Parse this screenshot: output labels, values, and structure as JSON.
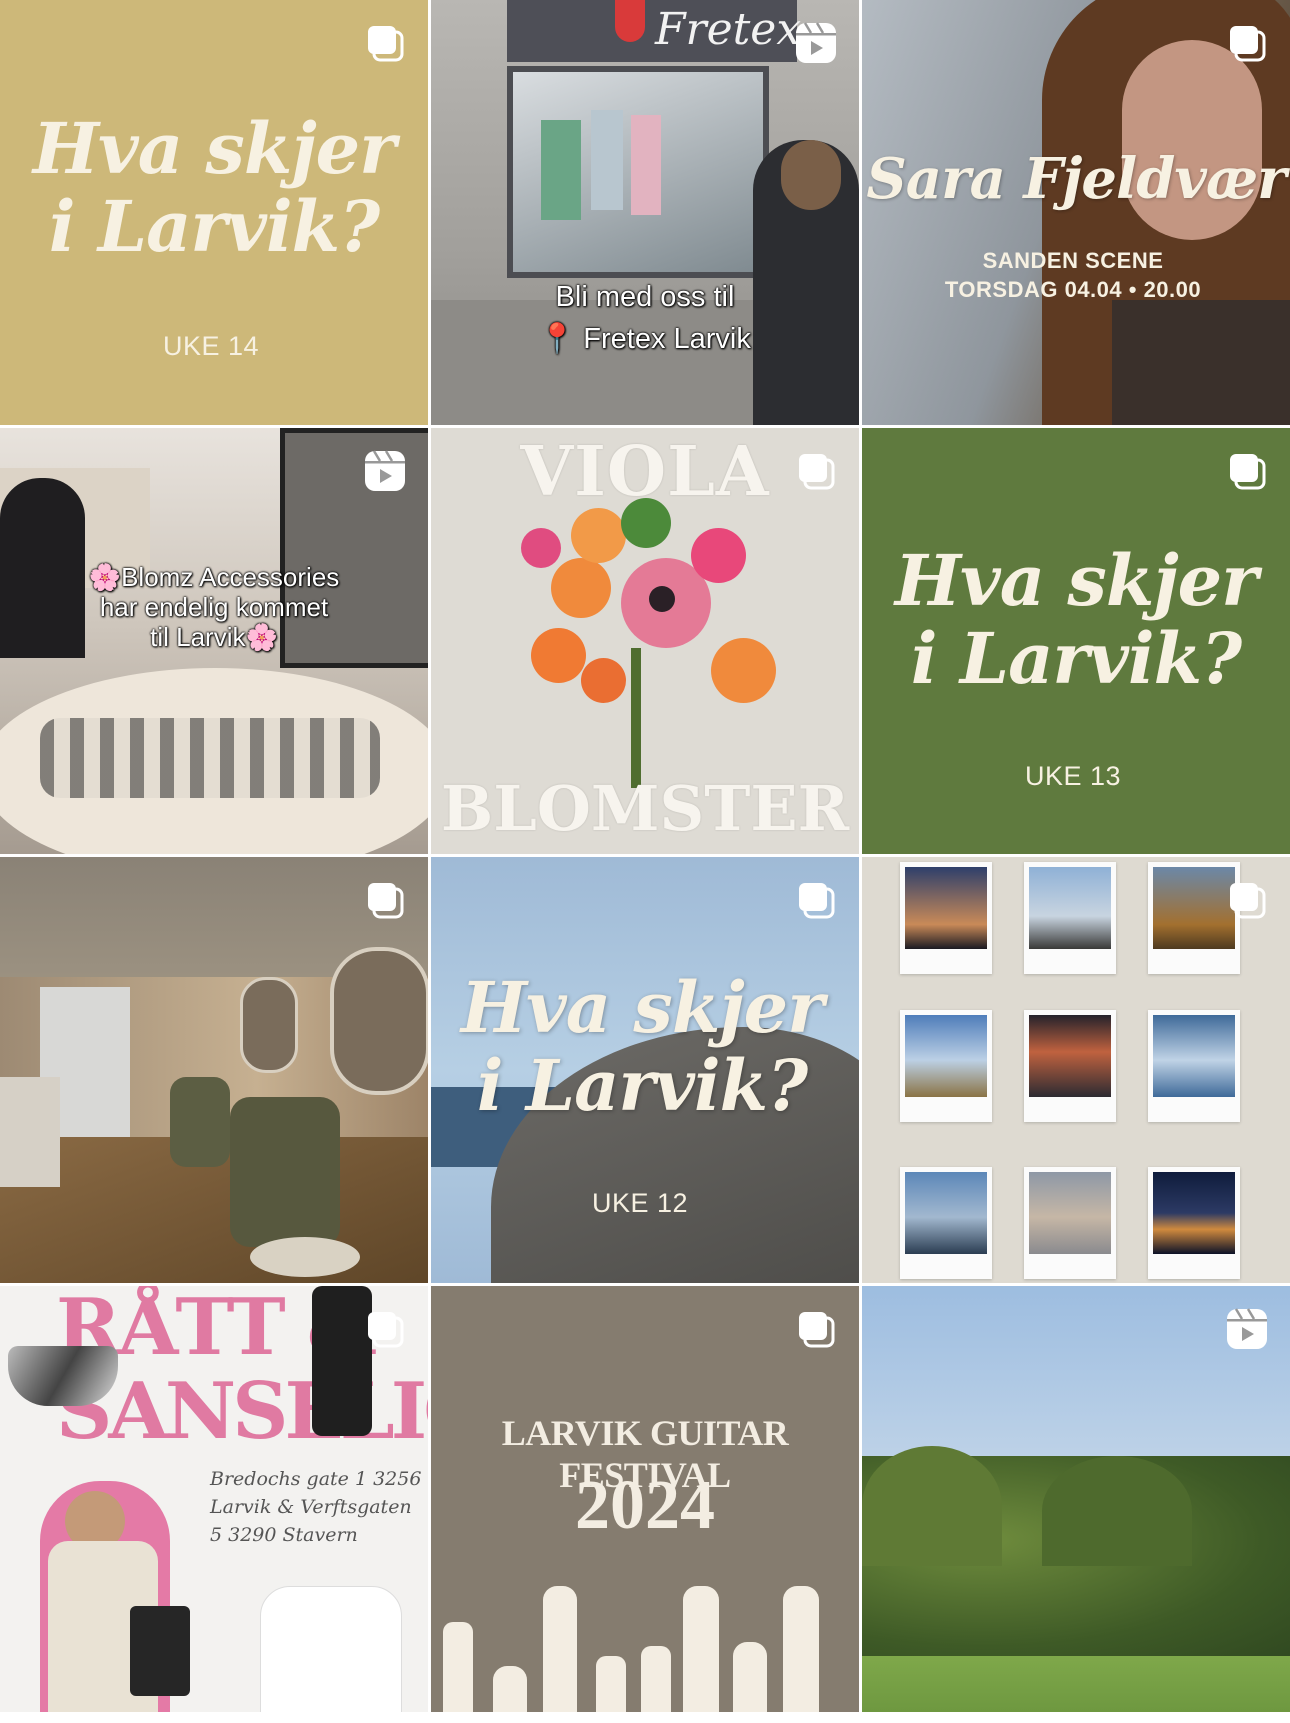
{
  "tiles": {
    "t1": {
      "title_line1": "Hva skjer",
      "title_line2": "i Larvik?",
      "week": "UKE 14",
      "badge": "carousel-icon",
      "bg": "#cdb879"
    },
    "t2": {
      "sign": "Fretex",
      "caption_line1": "Bli med oss til",
      "caption_line2": "📍 Fretex Larvik",
      "badge": "reel-icon"
    },
    "t3": {
      "title": "Sara Fjeldvær",
      "line1": "SANDEN SCENE",
      "line2": "TORSDAG 04.04 • 20.00",
      "badge": "carousel-icon"
    },
    "t4": {
      "caption_line1": "🌸Blomz Accessories",
      "caption_line2": "har endelig kommet",
      "caption_line3": "til Larvik🌸",
      "badge": "reel-icon"
    },
    "t5": {
      "top": "VIOLA",
      "bottom": "BLOMSTER",
      "badge": "carousel-icon"
    },
    "t6": {
      "title_line1": "Hva skjer",
      "title_line2": "i Larvik?",
      "week": "UKE 13",
      "badge": "carousel-icon",
      "bg": "#5f7a3e"
    },
    "t7": {
      "badge": "carousel-icon"
    },
    "t8": {
      "title_line1": "Hva skjer",
      "title_line2": "i Larvik?",
      "week": "UKE 12",
      "badge": "carousel-icon"
    },
    "t9": {
      "badge": "carousel-icon"
    },
    "t10": {
      "title_line1": "RÅTT &",
      "title_line2": "SANSELIG",
      "addr1": "Bredochs gate 1 3256",
      "addr2": "Larvik & Verftsgaten",
      "addr3": "5 3290 Stavern",
      "badge": "carousel-icon"
    },
    "t11": {
      "title": "LARVIK GUITAR FESTIVAL",
      "year": "2024",
      "badge": "carousel-icon",
      "bg": "#857c6f"
    },
    "t12": {
      "badge": "reel-icon"
    }
  }
}
